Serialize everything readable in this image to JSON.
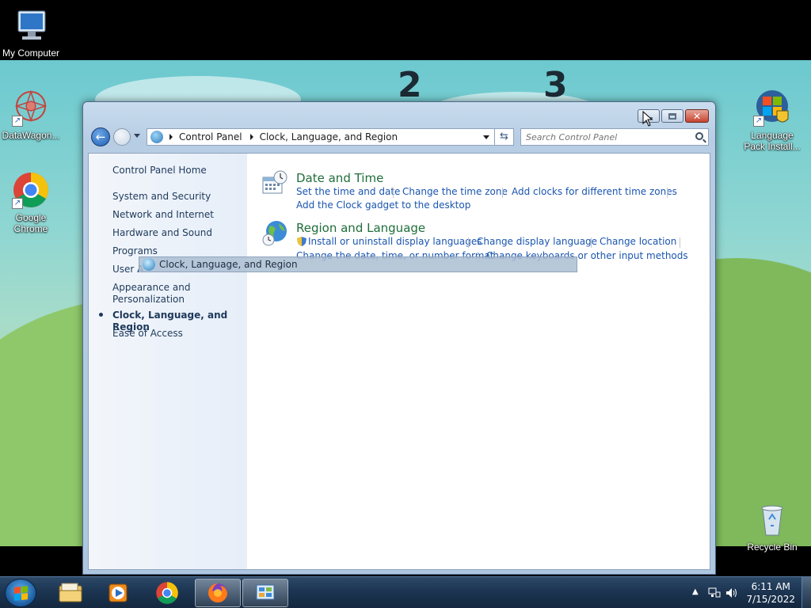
{
  "desktop": {
    "icons": [
      {
        "label": "My Computer",
        "icon": "computer-icon"
      },
      {
        "label": "DataWagon...",
        "icon": "datawagon-icon"
      },
      {
        "label": "Google Chrome",
        "icon": "chrome-icon"
      },
      {
        "label": "Language Pack Install...",
        "icon": "windows-shield-icon"
      },
      {
        "label": "Recycle Bin",
        "icon": "recycle-bin-icon"
      }
    ]
  },
  "window": {
    "address": {
      "crumbs": [
        "Control Panel",
        "Clock, Language, and Region"
      ]
    },
    "search": {
      "placeholder": "Search Control Panel"
    },
    "sidebar": {
      "home": "Control Panel Home",
      "items": [
        "System and Security",
        "Network and Internet",
        "Hardware and Sound",
        "Programs",
        "User A",
        "Appearance and",
        "Personalization",
        "Clock, Language, and Region",
        "Ease of Access"
      ],
      "current": "Clock, Language, and Region"
    },
    "categories": [
      {
        "title": "Date and Time",
        "icon": "clock-calendar-icon",
        "links": [
          "Set the time and date",
          "Change the time zone",
          "Add clocks for different time zones",
          "Add the Clock gadget to the desktop"
        ]
      },
      {
        "title": "Region and Language",
        "icon": "globe-clock-icon",
        "links": [
          "Install or uninstall display languages",
          "Change display language",
          "Change location",
          "Change the date, time, or number format",
          "Change keyboards or other input methods"
        ]
      }
    ],
    "drag_ghost": "Clock, Language, and Region"
  },
  "taskbar": {
    "pinned": [
      "windows-explorer-icon",
      "media-player-icon",
      "chrome-icon",
      "firefox-icon",
      "control-panel-icon"
    ],
    "active": "control-panel-icon",
    "clock": {
      "time": "6:11 AM",
      "date": "7/15/2022"
    }
  },
  "colors": {
    "link": "#1a55b0",
    "category_title": "#1e6e3a",
    "sidebar_text": "#1e395b"
  }
}
